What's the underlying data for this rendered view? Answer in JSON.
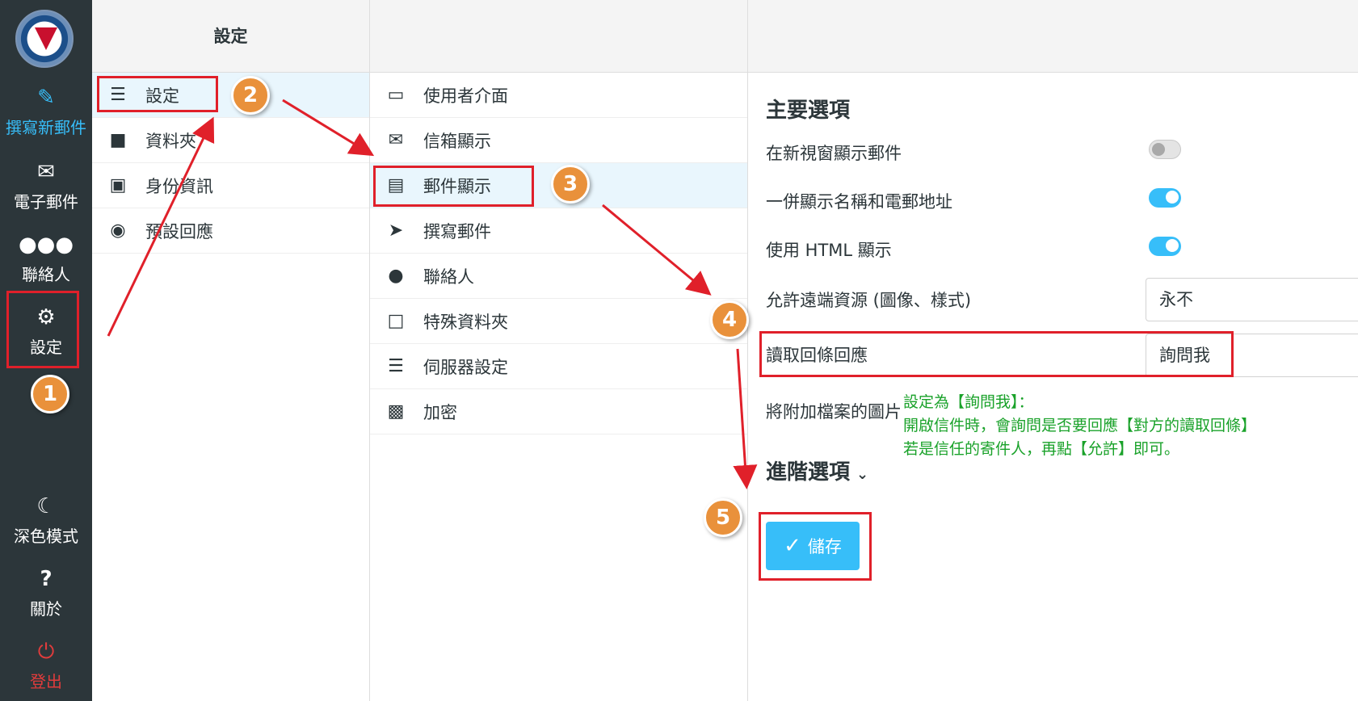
{
  "nav": {
    "compose": {
      "label": "撰寫新郵件",
      "icon": "compose-icon"
    },
    "mail": {
      "label": "電子郵件",
      "icon": "envelope-icon"
    },
    "contacts": {
      "label": "聯絡人",
      "icon": "users-icon"
    },
    "settings": {
      "label": "設定",
      "icon": "gear-icon"
    },
    "dark": {
      "label": "深色模式",
      "icon": "moon-icon"
    },
    "about": {
      "label": "關於",
      "icon": "question-icon"
    },
    "logout": {
      "label": "登出",
      "icon": "power-icon"
    }
  },
  "settings_col": {
    "title": "設定",
    "items": [
      {
        "label": "設定",
        "icon": "sliders-icon"
      },
      {
        "label": "資料夾",
        "icon": "folder-icon"
      },
      {
        "label": "身份資訊",
        "icon": "id-card-icon"
      },
      {
        "label": "預設回應",
        "icon": "comment-icon"
      }
    ]
  },
  "sections_col": {
    "items": [
      {
        "label": "使用者介面",
        "icon": "monitor-icon"
      },
      {
        "label": "信箱顯示",
        "icon": "envelope-icon"
      },
      {
        "label": "郵件顯示",
        "icon": "inbox-icon"
      },
      {
        "label": "撰寫郵件",
        "icon": "paper-plane-icon"
      },
      {
        "label": "聯絡人",
        "icon": "users-icon"
      },
      {
        "label": "特殊資料夾",
        "icon": "folder-open-icon"
      },
      {
        "label": "伺服器設定",
        "icon": "server-icon"
      },
      {
        "label": "加密",
        "icon": "lock-icon"
      }
    ]
  },
  "main": {
    "section_title": "主要選項",
    "rows": [
      {
        "label": "在新視窗顯示郵件",
        "state": "off"
      },
      {
        "label": "一併顯示名稱和電郵地址",
        "state": "on"
      },
      {
        "label": "使用 HTML 顯示",
        "state": "on"
      }
    ],
    "remote_label": "允許遠端資源 (圖像、樣式)",
    "remote_value": "永不",
    "receipt_label": "讀取回條回應",
    "receipt_value": "詢問我",
    "attach_label": "將附加檔案的圖片",
    "advanced_label": "進階選項",
    "save_label": "儲存"
  },
  "annotations": {
    "badges": [
      "1",
      "2",
      "3",
      "4",
      "5"
    ],
    "note_lines": [
      "設定為【詢問我】：",
      "開啟信件時，會詢問是否要回應【對方的讀取回條】",
      "若是信任的寄件人，再點【允許】即可。"
    ]
  },
  "colors": {
    "accent": "#37bef9",
    "nav_bg": "#2c363a",
    "annotation_red": "#e0202a",
    "badge_orange": "#e9913b",
    "note_green": "#1aa22a"
  }
}
